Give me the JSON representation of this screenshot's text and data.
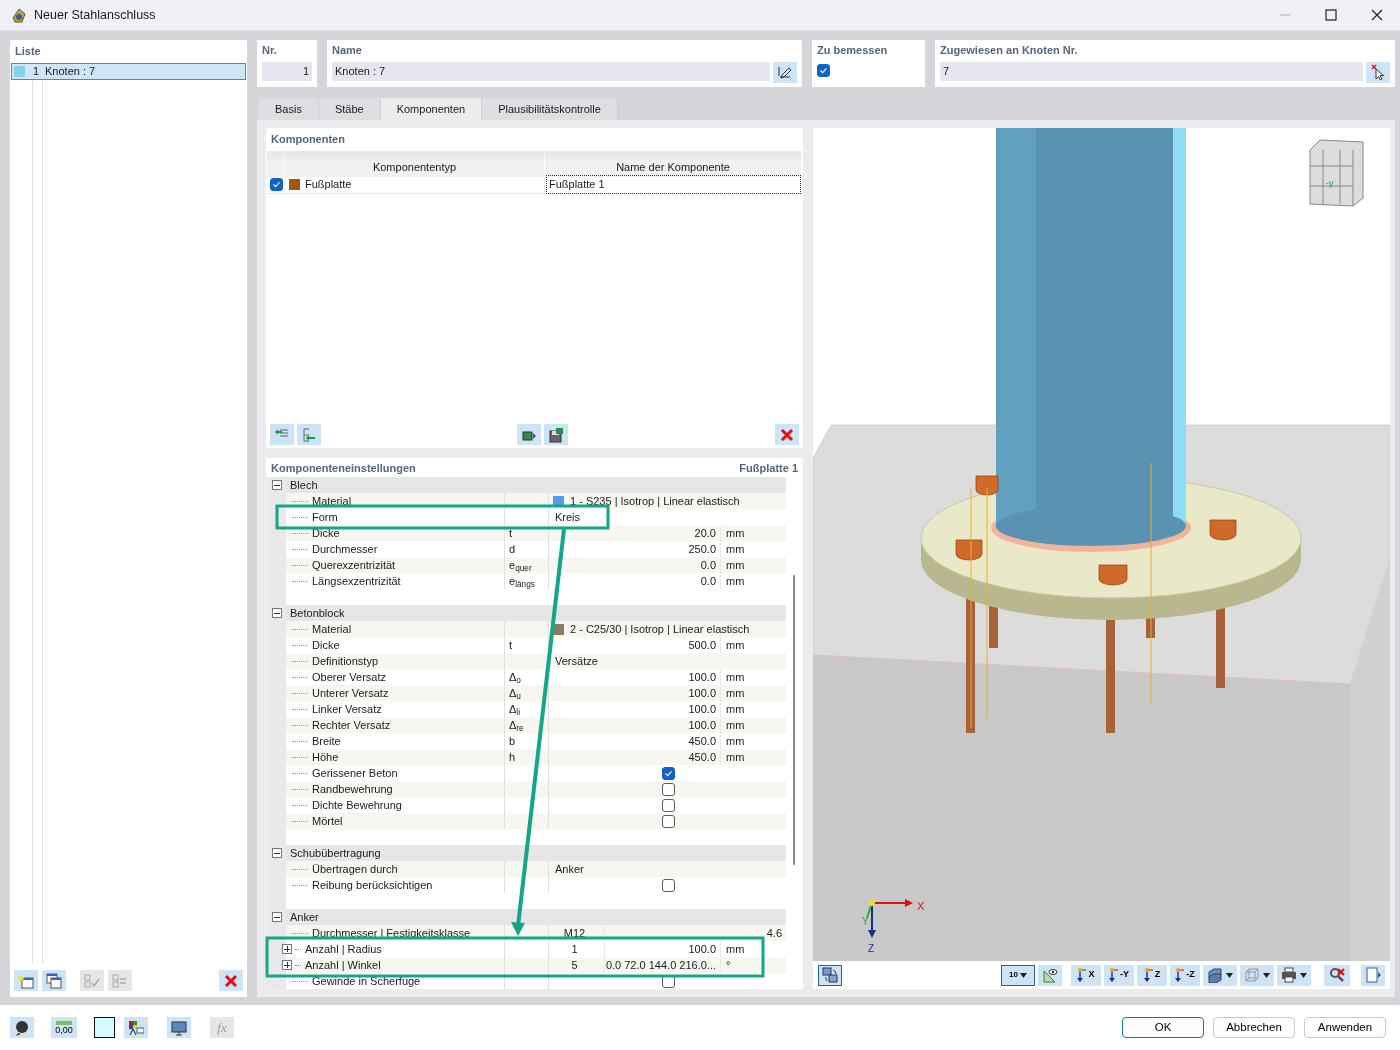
{
  "window": {
    "title": "Neuer Stahlanschluss"
  },
  "list": {
    "title": "Liste",
    "items": [
      {
        "number": "1",
        "name": "Knoten : 7",
        "color": "#86d0ee",
        "selected": true
      }
    ]
  },
  "header": {
    "number": {
      "label": "Nr.",
      "value": "1"
    },
    "name": {
      "label": "Name",
      "value": "Knoten : 7"
    },
    "design": {
      "label": "Zu bemessen",
      "checked": true
    },
    "assigned": {
      "label": "Zugewiesen an Knoten Nr.",
      "value": "7"
    }
  },
  "tabs": [
    {
      "label": "Basis",
      "selected": false
    },
    {
      "label": "Stäbe",
      "selected": false
    },
    {
      "label": "Komponenten",
      "selected": true
    },
    {
      "label": "Plausibilitätskontrolle",
      "selected": false
    }
  ],
  "components": {
    "title": "Komponenten",
    "columns": [
      "Komponententyp",
      "Name der Komponente"
    ],
    "rows": [
      {
        "checked": true,
        "color": "#a0580f",
        "type": "Fußplatte",
        "name": "Fußplatte 1"
      }
    ]
  },
  "settings": {
    "title": "Komponenteneinstellungen",
    "component": "Fußplatte 1",
    "groups": [
      {
        "name": "Blech",
        "expanded": true,
        "rows": [
          {
            "kind": "material",
            "label": "Material",
            "color": "#4f9cf0",
            "value": "1 - S235 | Isotrop | Linear elastisch"
          },
          {
            "kind": "text",
            "label": "Form",
            "value": "Kreis",
            "highlighted": true
          },
          {
            "kind": "number",
            "label": "Dicke",
            "symbol": "t",
            "value": "20.0",
            "unit": "mm"
          },
          {
            "kind": "number",
            "label": "Durchmesser",
            "symbol": "d",
            "value": "250.0",
            "unit": "mm"
          },
          {
            "kind": "number",
            "label": "Querexzentrizität",
            "symbol": "e$_{quer}$",
            "value": "0.0",
            "unit": "mm"
          },
          {
            "kind": "number",
            "label": "Längsexzentrizität",
            "symbol": "e$_{längs}$",
            "value": "0.0",
            "unit": "mm"
          }
        ]
      },
      {
        "name": "Betonblock",
        "expanded": true,
        "rows": [
          {
            "kind": "material",
            "label": "Material",
            "color": "#8b7a5e",
            "value": "2 - C25/30 | Isotrop | Linear elastisch"
          },
          {
            "kind": "number",
            "label": "Dicke",
            "symbol": "t",
            "value": "500.0",
            "unit": "mm"
          },
          {
            "kind": "text",
            "label": "Definitionstyp",
            "value": "Versätze"
          },
          {
            "kind": "number",
            "label": "Oberer Versatz",
            "symbol": "Δ$_{o}$",
            "value": "100.0",
            "unit": "mm"
          },
          {
            "kind": "number",
            "label": "Unterer Versatz",
            "symbol": "Δ$_{u}$",
            "value": "100.0",
            "unit": "mm"
          },
          {
            "kind": "number",
            "label": "Linker Versatz",
            "symbol": "Δ$_{li}$",
            "value": "100.0",
            "unit": "mm"
          },
          {
            "kind": "number",
            "label": "Rechter Versatz",
            "symbol": "Δ$_{re}$",
            "value": "100.0",
            "unit": "mm"
          },
          {
            "kind": "number",
            "label": "Breite",
            "symbol": "b",
            "value": "450.0",
            "unit": "mm"
          },
          {
            "kind": "number",
            "label": "Höhe",
            "symbol": "h",
            "value": "450.0",
            "unit": "mm"
          },
          {
            "kind": "check",
            "label": "Gerissener Beton",
            "checked": true
          },
          {
            "kind": "check",
            "label": "Randbewehrung",
            "checked": false
          },
          {
            "kind": "check",
            "label": "Dichte Bewehrung",
            "checked": false
          },
          {
            "kind": "check",
            "label": "Mörtel",
            "checked": false
          }
        ]
      },
      {
        "name": "Schubübertragung",
        "expanded": true,
        "rows": [
          {
            "kind": "text",
            "label": "Übertragen durch",
            "value": "Anker"
          },
          {
            "kind": "check",
            "label": "Reibung berücksichtigen",
            "checked": false
          }
        ]
      },
      {
        "name": "Anker",
        "expanded": true,
        "rows": [
          {
            "kind": "pair",
            "label": "Durchmesser | Festigkeitsklasse",
            "value": "M12",
            "value_2": "4.6"
          },
          {
            "kind": "pair",
            "label": "Anzahl | Radius",
            "value": "1",
            "value_2": "100.0",
            "unit": "mm",
            "expandable": true,
            "highlighted": true
          },
          {
            "kind": "pair",
            "label": "Anzahl | Winkel",
            "value": "5",
            "value_2": "0.0 72.0 144.0 216.0...",
            "unit": "°",
            "expandable": true,
            "highlighted": true
          },
          {
            "kind": "check",
            "label": "Gewinde in Scherfuge",
            "checked": false
          }
        ]
      }
    ]
  },
  "viewport": {
    "cube_label": "-y",
    "axes": [
      "X",
      "Y",
      "Z"
    ],
    "scale_label": "10",
    "view_buttons": [
      "X",
      "-Y",
      "Z",
      "-Z"
    ]
  },
  "footer": {
    "format_label": "0,00",
    "function_label": "fx"
  },
  "buttons": [
    {
      "label": "OK",
      "default": true
    },
    {
      "label": "Abbrechen",
      "default": false
    },
    {
      "label": "Anwenden",
      "default": false
    }
  ]
}
